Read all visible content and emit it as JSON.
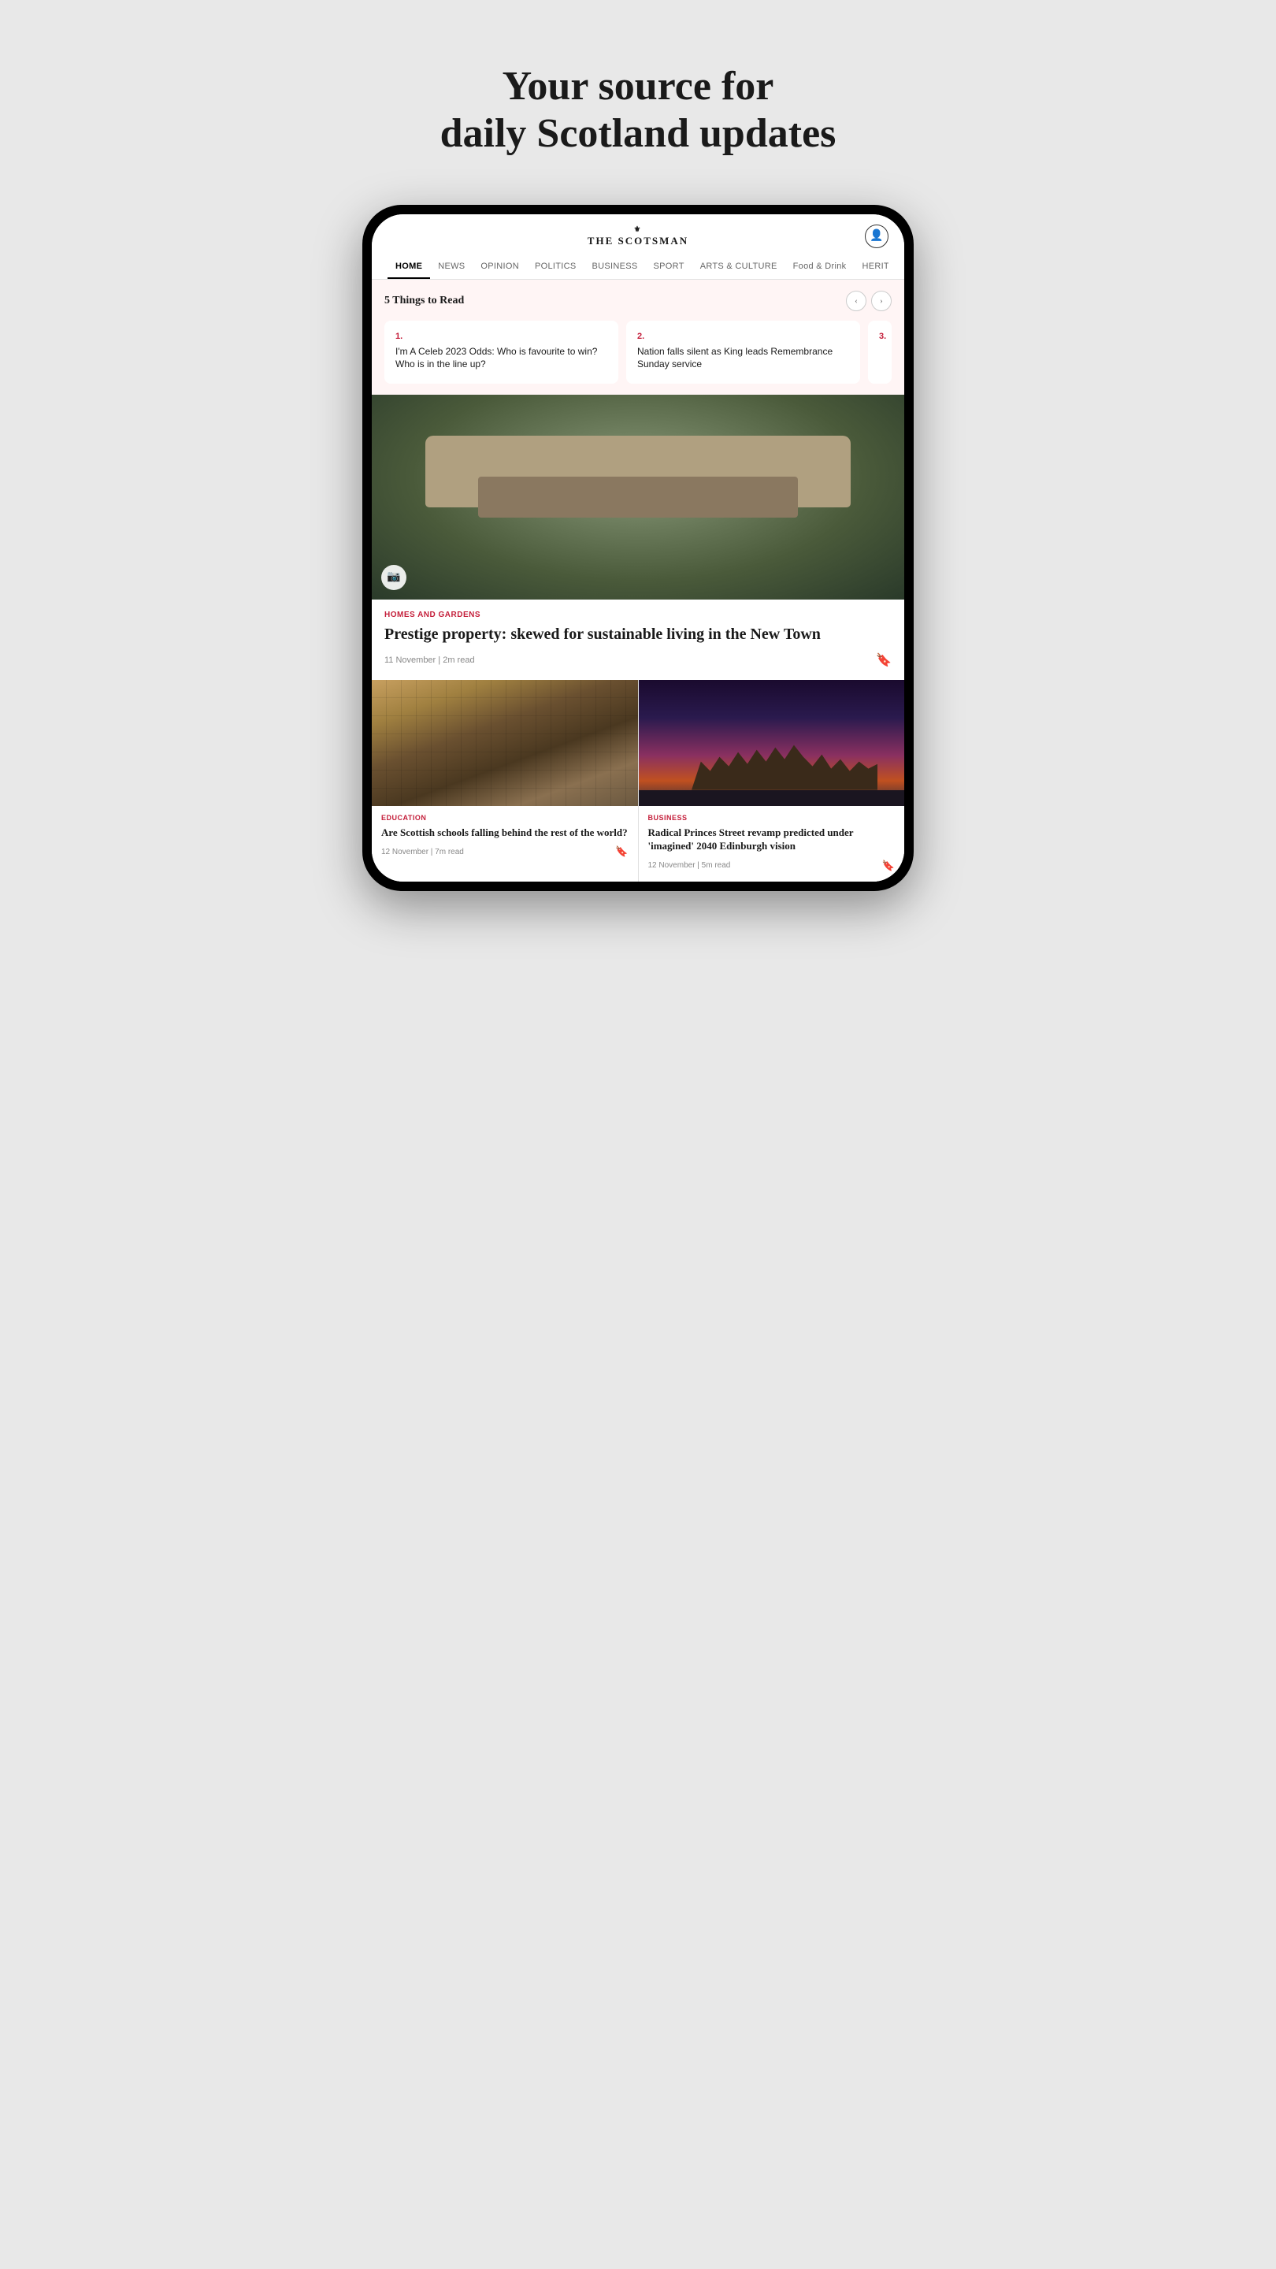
{
  "hero": {
    "title_line1": "Your source for",
    "title_line2": "daily Scotland updates"
  },
  "app": {
    "logo": "THE SCOTSMAN",
    "logo_icon": "⚜",
    "nav_tabs": [
      {
        "label": "HOME",
        "active": true
      },
      {
        "label": "NEWS",
        "active": false
      },
      {
        "label": "OPINION",
        "active": false
      },
      {
        "label": "POLITICS",
        "active": false
      },
      {
        "label": "BUSINESS",
        "active": false
      },
      {
        "label": "SPORT",
        "active": false
      },
      {
        "label": "ARTS & CULTURE",
        "active": false
      },
      {
        "label": "Food & Drink",
        "active": false
      },
      {
        "label": "HERITAGE",
        "active": false
      }
    ]
  },
  "five_things": {
    "title": "5 Things to Read",
    "items": [
      {
        "number": "1.",
        "text": "I'm A Celeb 2023 Odds: Who is favourite to win? Who is in the line up?"
      },
      {
        "number": "2.",
        "text": "Nation falls silent as King leads Remembrance Sunday service"
      },
      {
        "number": "3.",
        "text": ""
      }
    ]
  },
  "main_article": {
    "category": "Homes And Gardens",
    "title": "Prestige property: skewed for sustainable living in the New Town",
    "date": "11 November",
    "read_time": "2m read"
  },
  "grid_articles": [
    {
      "category": "Education",
      "title": "Are Scottish schools falling behind the rest of the world?",
      "date": "12 November",
      "read_time": "7m read",
      "type": "exam"
    },
    {
      "category": "Business",
      "title": "Radical Princes Street revamp predicted under 'imagined' 2040 Edinburgh vision",
      "date": "12 November",
      "read_time": "5m read",
      "type": "edinburgh"
    }
  ],
  "icons": {
    "user": "👤",
    "camera": "📷",
    "bookmark": "🔖",
    "arrow_left": "‹",
    "arrow_right": "›"
  }
}
